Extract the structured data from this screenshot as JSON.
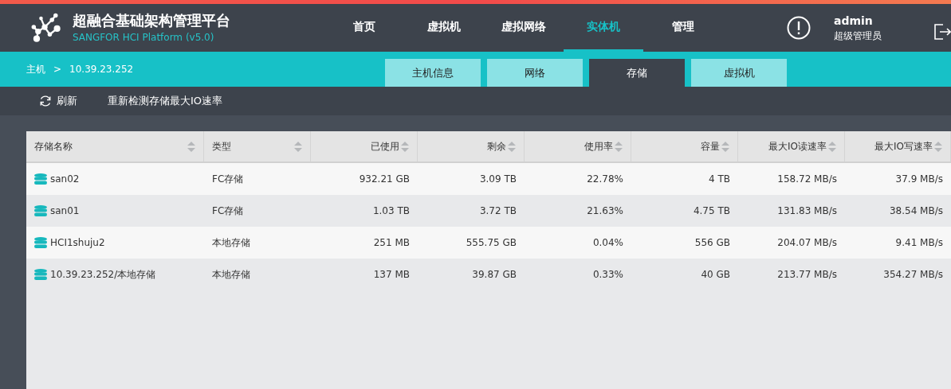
{
  "header": {
    "title": "超融合基础架构管理平台",
    "subtitle": "SANGFOR HCI Platform (v5.0)",
    "nav": [
      {
        "label": "首页",
        "selected": false
      },
      {
        "label": "虚拟机",
        "selected": false
      },
      {
        "label": "虚拟网络",
        "selected": false
      },
      {
        "label": "实体机",
        "selected": true
      },
      {
        "label": "管理",
        "selected": false
      }
    ],
    "user": {
      "name": "admin",
      "role": "超级管理员"
    }
  },
  "breadcrumb": [
    "主机",
    ">",
    "10.39.23.252"
  ],
  "tabs": [
    {
      "label": "主机信息",
      "selected": false
    },
    {
      "label": "网络",
      "selected": false
    },
    {
      "label": "存储",
      "selected": true
    },
    {
      "label": "虚拟机",
      "selected": false
    }
  ],
  "toolbar": {
    "refresh": "刷新",
    "recheck": "重新检测存储最大IO速率"
  },
  "table": {
    "columns": [
      "存储名称",
      "类型",
      "已使用",
      "剩余",
      "使用率",
      "容量",
      "最大IO读速率",
      "最大IO写速率"
    ],
    "rows": [
      [
        "san02",
        "FC存储",
        "932.21 GB",
        "3.09 TB",
        "22.78%",
        "4 TB",
        "158.72 MB/s",
        "37.9 MB/s"
      ],
      [
        "san01",
        "FC存储",
        "1.03 TB",
        "3.72 TB",
        "21.63%",
        "4.75 TB",
        "131.83 MB/s",
        "38.54 MB/s"
      ],
      [
        "HCI1shuju2",
        "本地存储",
        "251 MB",
        "555.75 GB",
        "0.04%",
        "556 GB",
        "204.07 MB/s",
        "9.41 MB/s"
      ],
      [
        "10.39.23.252/本地存储",
        "本地存储",
        "137 MB",
        "39.87 GB",
        "0.33%",
        "40 GB",
        "213.77 MB/s",
        "354.27 MB/s"
      ]
    ]
  }
}
